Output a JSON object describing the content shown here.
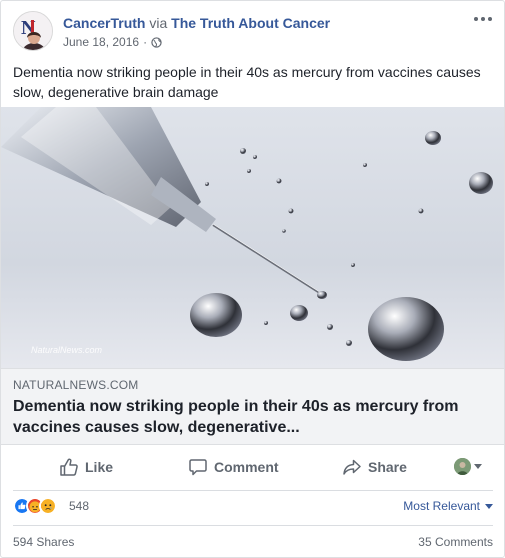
{
  "post": {
    "author": "CancerTruth",
    "via_text": "via",
    "page": "The Truth About Cancer",
    "date": "June 18, 2016",
    "separator": "·",
    "privacy_icon": "globe-icon",
    "more_icon": "more-options-icon",
    "text": "Dementia now striking people in their 40s as mercury from vaccines causes slow, degenerative brain damage"
  },
  "link": {
    "image_watermark": "NaturalNews.com",
    "domain": "NATURALNEWS.COM",
    "title": "Dementia now striking people in their 40s as mercury from vaccines causes slow, degenerative..."
  },
  "actions": {
    "like_label": "Like",
    "comment_label": "Comment",
    "share_label": "Share"
  },
  "reactions": {
    "types": [
      "like",
      "angry",
      "sad"
    ],
    "count": "548",
    "sort_label": "Most Relevant"
  },
  "footer": {
    "shares": "594 Shares",
    "comments": "35 Comments"
  },
  "colors": {
    "link_blue": "#365899",
    "meta_gray": "#616770",
    "like_blue": "#1877f2",
    "angry_orange": "#f0573b",
    "sad_yellow": "#f7b125",
    "caption_bg": "#f2f3f5"
  }
}
